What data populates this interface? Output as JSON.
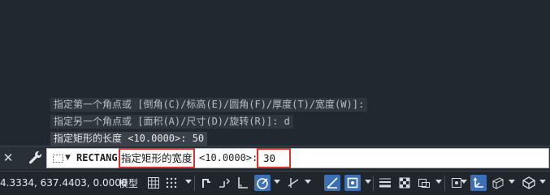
{
  "history": [
    "指定第一个角点或 [倒角(C)/标高(E)/圆角(F)/厚度(T)/宽度(W)]:",
    "指定另一个角点或 [面积(A)/尺寸(D)/旋转(R)]: d",
    "指定矩形的长度 <10.0000>: 50"
  ],
  "command_line": {
    "close_glyph": "✕",
    "command_name": "RECTANG",
    "prompt": "指定矩形的宽度",
    "default_value": "<10.0000>: ",
    "input_value": "30"
  },
  "status_bar": {
    "coordinates": "4.3334, 637.4403, 0.0000",
    "model_tab": "模型"
  },
  "colors": {
    "background": "#212830",
    "highlight_border": "#e0302c",
    "active_toggle": "#3c6fb3"
  },
  "icons": [
    "close-icon",
    "wrench-icon",
    "rectangle-icon",
    "grid-icon",
    "snap-icon",
    "ortho-icon",
    "polar-icon",
    "isodraft-icon",
    "osnap-icon",
    "lineweight-icon",
    "transparency-icon",
    "selection-cycling-icon",
    "annotation-icon",
    "workspace-icon"
  ]
}
